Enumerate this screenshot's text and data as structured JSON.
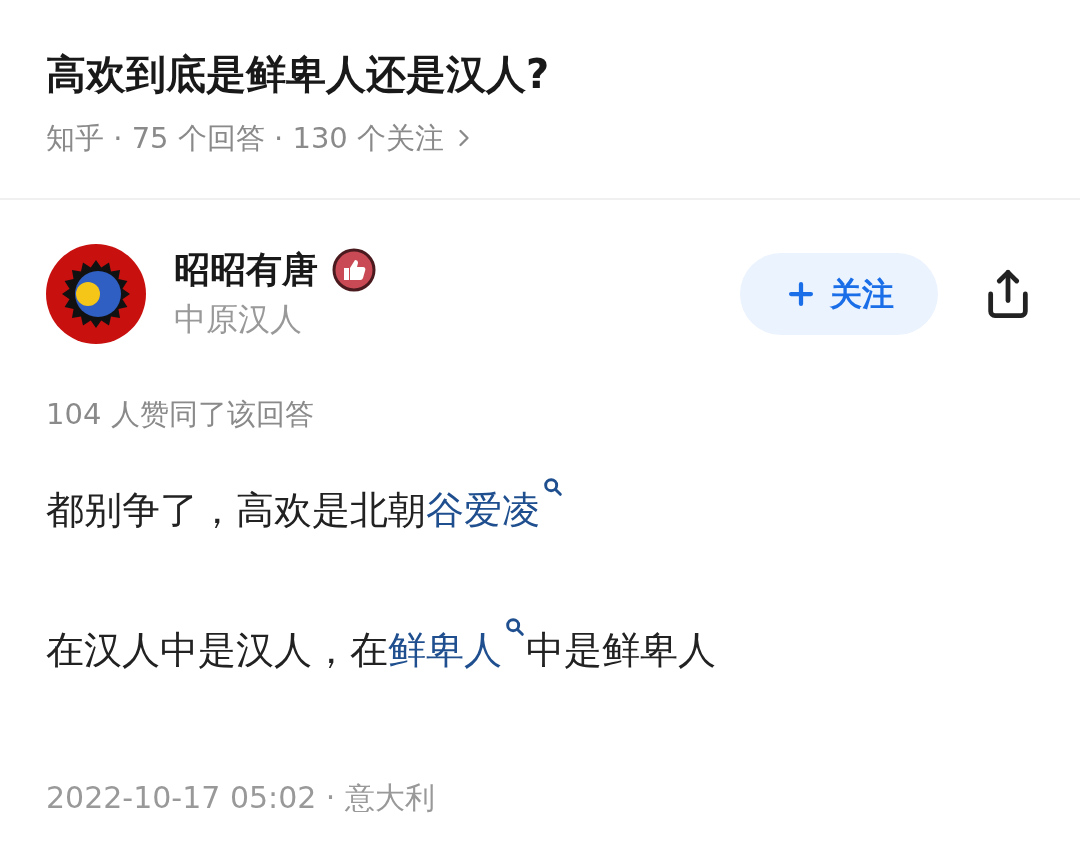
{
  "question": {
    "title": "高欢到底是鲜卑人还是汉人?",
    "meta": "知乎 · 75 个回答 · 130 个关注"
  },
  "author": {
    "name": "昭昭有唐",
    "bio": "中原汉人",
    "follow_button": "关注"
  },
  "upvotes": "104 人赞同了该回答",
  "paragraphs": [
    {
      "segments": [
        {
          "kind": "text",
          "text": "都别争了，高欢是北朝"
        },
        {
          "kind": "link",
          "text": "谷爱凌"
        }
      ]
    },
    {
      "segments": [
        {
          "kind": "text",
          "text": "在汉人中是汉人，在"
        },
        {
          "kind": "link",
          "text": "鲜卑人"
        },
        {
          "kind": "text",
          "text": "中是鲜卑人"
        }
      ]
    }
  ],
  "footer": "2022-10-17 05:02 · 意大利"
}
